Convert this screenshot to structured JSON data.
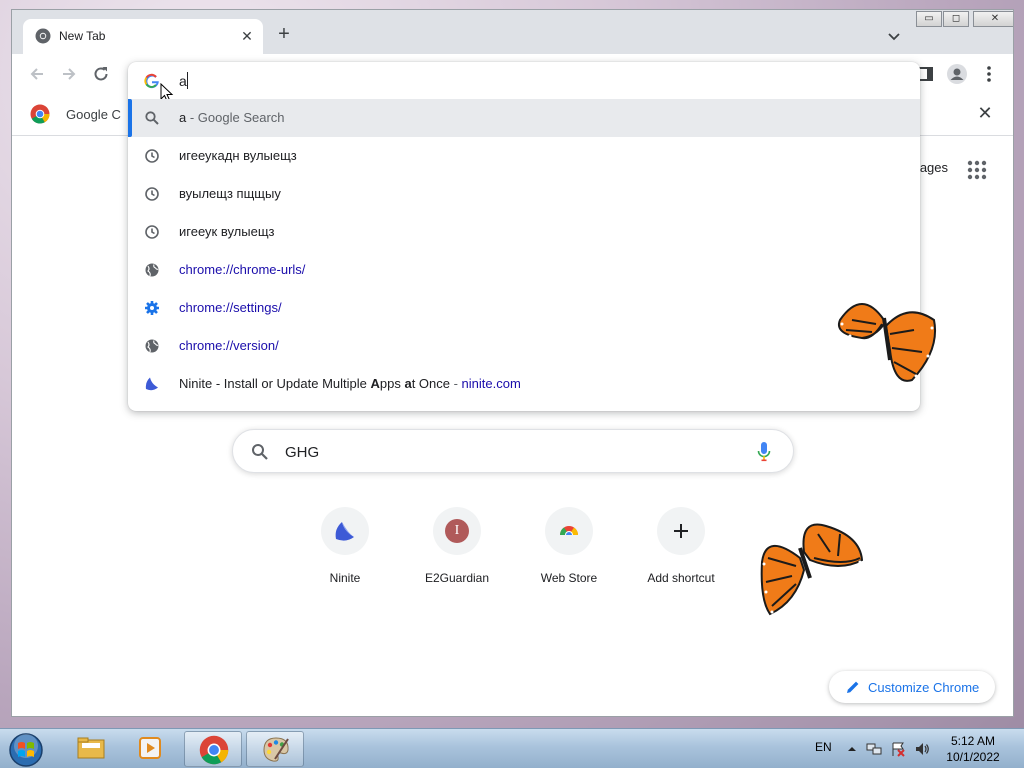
{
  "window": {
    "tab_title": "New Tab",
    "controls": {
      "minimize": "▭",
      "restore": "◻",
      "close": "✕"
    }
  },
  "bookmarks": {
    "item_label": "Google C"
  },
  "ntp": {
    "images_link": "mages",
    "search_text": "GHG",
    "shortcuts": [
      {
        "label": "Ninite",
        "icon": "ninite-icon"
      },
      {
        "label": "E2Guardian",
        "icon": "e2guardian-icon",
        "letter": "I"
      },
      {
        "label": "Web Store",
        "icon": "web-store-icon"
      },
      {
        "label": "Add shortcut",
        "icon": "plus-icon"
      }
    ],
    "customize_label": "Customize Chrome"
  },
  "omnibox": {
    "input_value": "a",
    "suggestions": [
      {
        "type": "search",
        "icon": "search-icon",
        "text": "a",
        "suffix": " - Google Search"
      },
      {
        "type": "history",
        "icon": "history-icon",
        "text": "игееукадн вулыещз"
      },
      {
        "type": "history",
        "icon": "history-icon",
        "text": "вуылещз пщщыу"
      },
      {
        "type": "history",
        "icon": "history-icon",
        "text": "игееук вулыещз"
      },
      {
        "type": "url",
        "icon": "globe-icon",
        "text": "chrome://chrome-urls/"
      },
      {
        "type": "url",
        "icon": "gear-icon",
        "text": "chrome://settings/"
      },
      {
        "type": "url",
        "icon": "globe-icon",
        "text": "chrome://version/"
      },
      {
        "type": "site",
        "icon": "ninite-icon",
        "text_pre": "Ninite - Install or Update Multiple ",
        "bold1": "A",
        "text_mid": "pps ",
        "bold2": "a",
        "text_post": "t Once",
        "sep": " - ",
        "domain": "ninite.com"
      }
    ]
  },
  "taskbar": {
    "lang": "EN",
    "time": "5:12 AM",
    "date": "10/1/2022"
  },
  "colors": {
    "accent": "#1a73e8",
    "link": "#1a0dab",
    "tabstrip": "#dee1e6",
    "selected_row": "#e8eaed"
  }
}
